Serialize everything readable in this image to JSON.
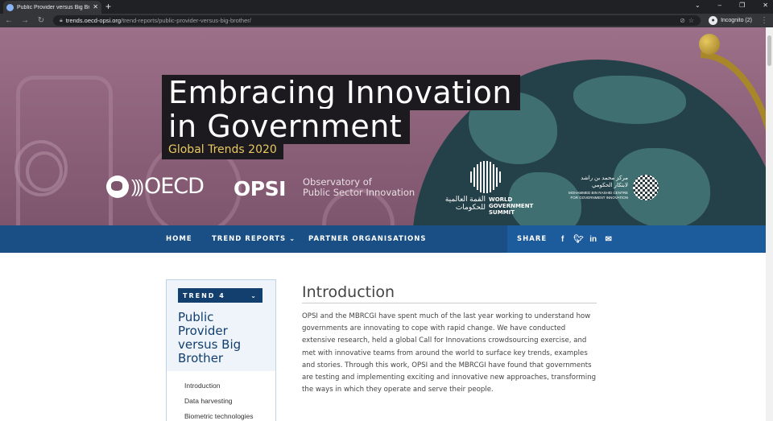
{
  "browser": {
    "tab_title": "Public Provider versus Big Brothe",
    "url_host": "trends.oecd-opsi.org",
    "url_path": "/trend-reports/public-provider-versus-big-brother/",
    "profile_label": "Incognito (2)"
  },
  "hero": {
    "title_line1": "Embracing Innovation",
    "title_line2": "in Government",
    "subtitle": "Global Trends 2020",
    "oecd_logo": "OECD",
    "opsi_logo": "OPSI",
    "opsi_sub_line1": "Observatory of",
    "opsi_sub_line2": "Public Sector Innovation",
    "wgs_arabic_line1": "القمة العالمية",
    "wgs_arabic_line2": "للحكومات",
    "wgs_line1": "WORLD",
    "wgs_line2": "GOVERNMENT",
    "wgs_line3": "SUMMIT",
    "mbr_arabic_line1": "مركز محمد بن راشد",
    "mbr_arabic_line2": "لابتكار الحكومي",
    "mbr_line1": "MOHAMMED BIN RASHID CENTRE",
    "mbr_line2": "FOR GOVERNMENT INNOVATION"
  },
  "nav": {
    "home": "HOME",
    "trend_reports": "TREND REPORTS",
    "partners": "PARTNER ORGANISATIONS",
    "share": "SHARE"
  },
  "sidebar": {
    "trend_label": "TREND 4",
    "title": "Public Provider versus Big Brother",
    "items": [
      "Introduction",
      "Data harvesting",
      "Biometric technologies"
    ]
  },
  "main": {
    "heading": "Introduction",
    "paragraph": "OPSI and the MBRCGI have spent much of the last year working to understand how governments are innovating to cope with rapid change. We have conducted extensive research, held a global Call for Innovations crowdsourcing exercise, and met with innovative teams from around the world to surface key trends, examples and stories. Through this work, OPSI and the MBRCGI have found that governments are testing and implementing exciting and innovative new approaches, transforming the ways in which they operate and serve their people."
  },
  "colors": {
    "hero_bg": "#8a5f78",
    "nav_bg": "#1a4f86",
    "share_bg": "#1c5b9c",
    "accent_gold": "#e8c860",
    "sidebar_title": "#123f6e"
  }
}
